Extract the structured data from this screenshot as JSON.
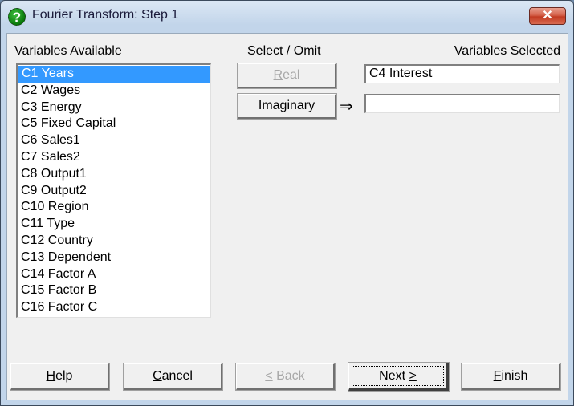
{
  "window": {
    "title": "Fourier Transform: Step 1",
    "title_icon": "help-question-icon",
    "close_symbol": "✕"
  },
  "variables_available": {
    "label": "Variables Available",
    "items": [
      {
        "label": "C1 Years",
        "selected": true
      },
      {
        "label": "C2 Wages",
        "selected": false
      },
      {
        "label": "C3 Energy",
        "selected": false
      },
      {
        "label": "C5 Fixed Capital",
        "selected": false
      },
      {
        "label": "C6 Sales1",
        "selected": false
      },
      {
        "label": "C7 Sales2",
        "selected": false
      },
      {
        "label": "C8 Output1",
        "selected": false
      },
      {
        "label": "C9 Output2",
        "selected": false
      },
      {
        "label": "C10 Region",
        "selected": false
      },
      {
        "label": "C11 Type",
        "selected": false
      },
      {
        "label": "C12 Country",
        "selected": false
      },
      {
        "label": "C13 Dependent",
        "selected": false
      },
      {
        "label": "C14 Factor A",
        "selected": false
      },
      {
        "label": "C15 Factor B",
        "selected": false
      },
      {
        "label": "C16 Factor C",
        "selected": false
      }
    ]
  },
  "select_omit": {
    "label": "Select / Omit",
    "real": {
      "label_mnemonic": "R",
      "label_rest": "eal",
      "enabled": false
    },
    "imaginary": {
      "label": "Imaginary",
      "enabled": true
    },
    "arrow": "⇒"
  },
  "variables_selected": {
    "label": "Variables Selected",
    "real_value": "C4 Interest",
    "imaginary_value": ""
  },
  "footer": {
    "help": {
      "mnemonic": "H",
      "rest": "elp"
    },
    "cancel": {
      "mnemonic": "C",
      "rest": "ancel"
    },
    "back": {
      "mnemonic": "<",
      "rest": " Back",
      "enabled": false
    },
    "next": {
      "prefix": "Next ",
      "mnemonic": ">",
      "default": true
    },
    "finish": {
      "mnemonic": "F",
      "rest": "inish"
    }
  }
}
